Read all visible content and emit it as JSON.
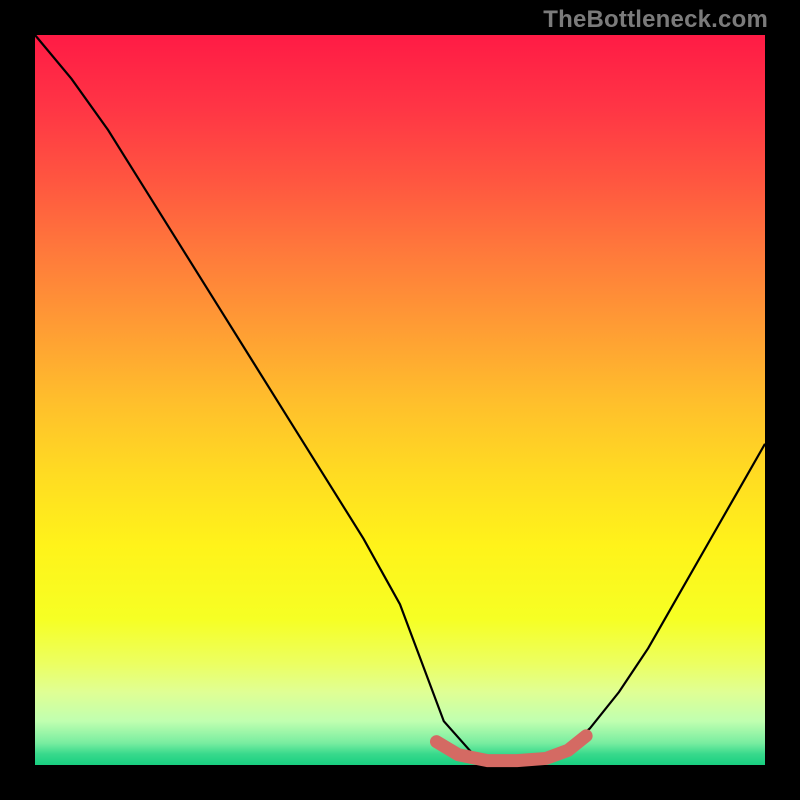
{
  "watermark": {
    "text": "TheBottleneck.com"
  },
  "chart_data": {
    "type": "line",
    "title": "",
    "xlabel": "",
    "ylabel": "",
    "xlim": [
      0,
      100
    ],
    "ylim": [
      0,
      100
    ],
    "grid": false,
    "legend": false,
    "background": {
      "kind": "vertical-gradient",
      "stops": [
        {
          "pos": 0.0,
          "color": "#ff1b45"
        },
        {
          "pos": 0.1,
          "color": "#ff3545"
        },
        {
          "pos": 0.2,
          "color": "#ff5640"
        },
        {
          "pos": 0.3,
          "color": "#ff7a3b"
        },
        {
          "pos": 0.4,
          "color": "#ff9c34"
        },
        {
          "pos": 0.5,
          "color": "#ffbe2c"
        },
        {
          "pos": 0.6,
          "color": "#ffdb22"
        },
        {
          "pos": 0.7,
          "color": "#fff31a"
        },
        {
          "pos": 0.8,
          "color": "#f6ff24"
        },
        {
          "pos": 0.86,
          "color": "#ecff60"
        },
        {
          "pos": 0.9,
          "color": "#e0ff94"
        },
        {
          "pos": 0.94,
          "color": "#c0ffb0"
        },
        {
          "pos": 0.97,
          "color": "#78eda0"
        },
        {
          "pos": 0.985,
          "color": "#38d98c"
        },
        {
          "pos": 1.0,
          "color": "#18cf80"
        }
      ]
    },
    "series": [
      {
        "name": "bottleneck-curve",
        "stroke": "#000000",
        "stroke_width": 2.2,
        "x": [
          0,
          5,
          10,
          15,
          20,
          25,
          30,
          35,
          40,
          45,
          50,
          53,
          56,
          60,
          64,
          68,
          72,
          76,
          80,
          84,
          88,
          92,
          96,
          100
        ],
        "y": [
          100,
          94,
          87,
          79,
          71,
          63,
          55,
          47,
          39,
          31,
          22,
          14,
          6,
          1.5,
          0.5,
          0.5,
          1.5,
          5,
          10,
          16,
          23,
          30,
          37,
          44
        ]
      },
      {
        "name": "optimal-zone",
        "stroke": "#d46a63",
        "stroke_width": 13,
        "linecap": "round",
        "x": [
          55,
          58,
          62,
          66,
          70,
          73,
          75.5
        ],
        "y": [
          3.2,
          1.4,
          0.6,
          0.6,
          0.9,
          2.0,
          4.0
        ]
      }
    ]
  }
}
